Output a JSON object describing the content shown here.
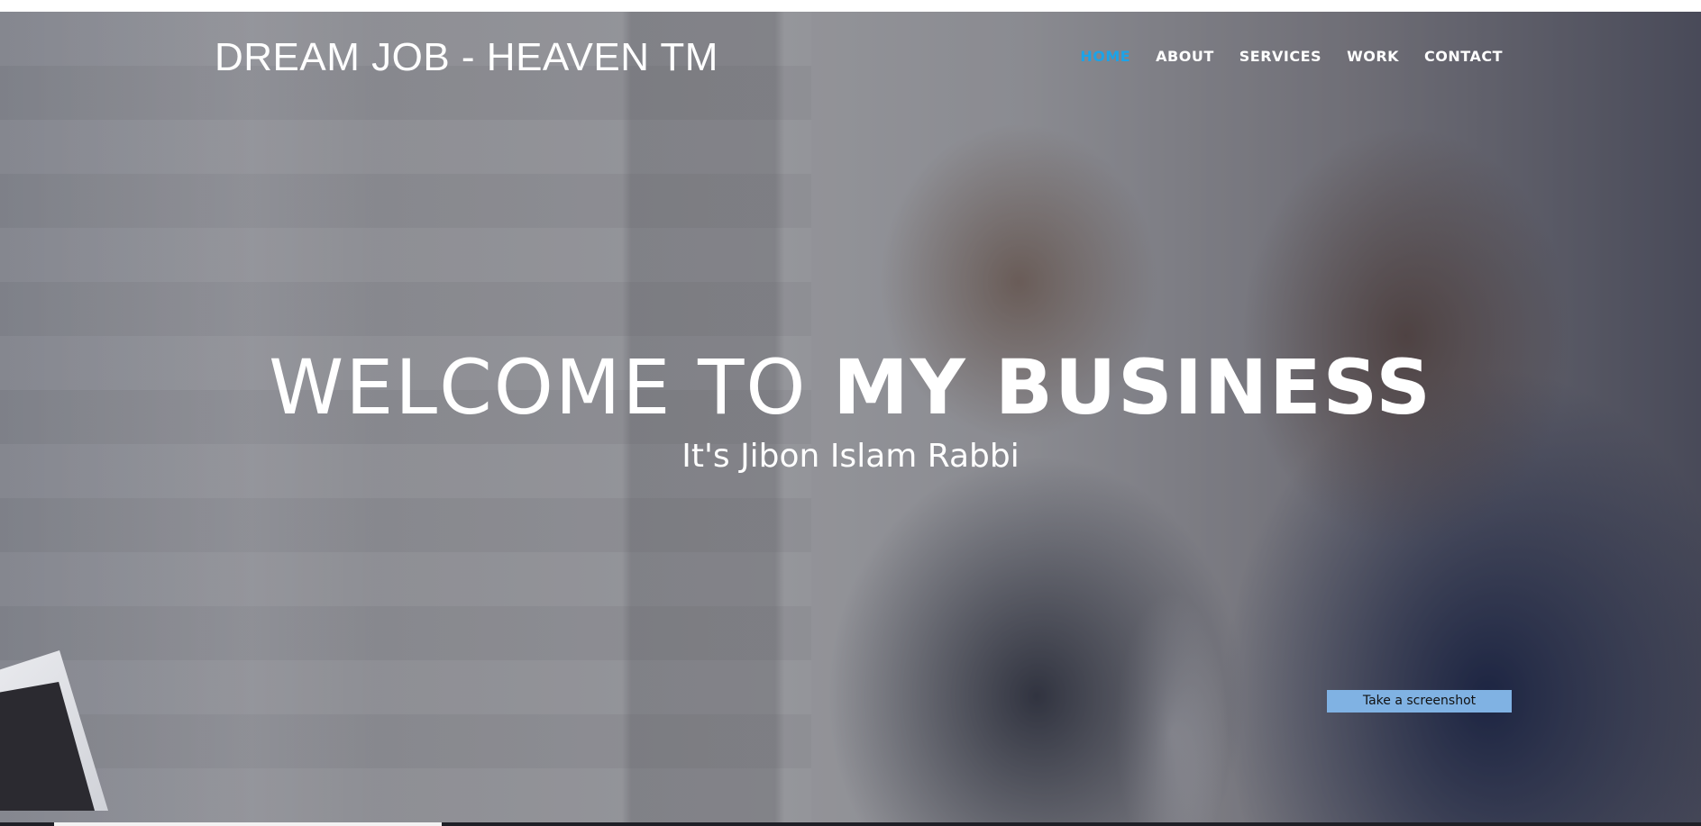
{
  "header": {
    "brand": "DREAM JOB - HEAVEN TM"
  },
  "nav": {
    "items": [
      {
        "label": "HOME",
        "active": true
      },
      {
        "label": "ABOUT",
        "active": false
      },
      {
        "label": "SERVICES",
        "active": false
      },
      {
        "label": "WORK",
        "active": false
      },
      {
        "label": "CONTACT",
        "active": false
      }
    ]
  },
  "hero": {
    "headline_light": "WELCOME TO",
    "headline_bold": "MY BUSINESS",
    "subtitle": "It's Jibon Islam Rabbi"
  },
  "tools": {
    "screenshot_button": "Take a screenshot"
  },
  "colors": {
    "nav_active": "#1ca3e8",
    "screenshot_button_bg": "#80b2e3",
    "text": "#ffffff"
  }
}
